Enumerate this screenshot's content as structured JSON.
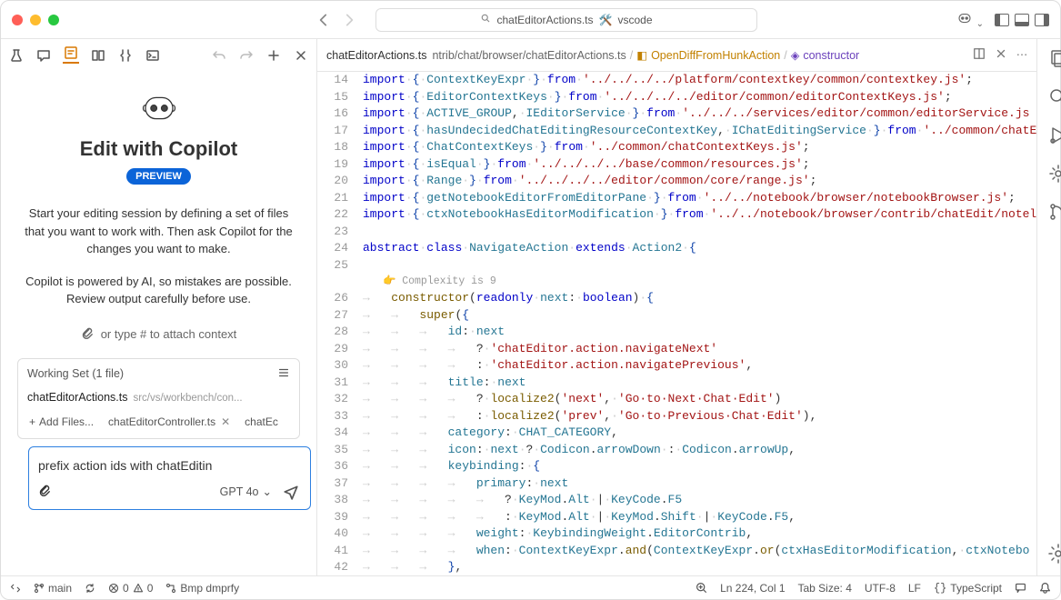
{
  "titlebar": {
    "command_center": "chatEditorActions.ts",
    "cc_badge": "vscode"
  },
  "sidebar": {
    "title": "Edit with Copilot",
    "preview": "PREVIEW",
    "desc1": "Start your editing session by defining a set of files that you want to work with. Then ask Copilot for the changes you want to make.",
    "desc2": "Copilot is powered by AI, so mistakes are possible. Review output carefully before use.",
    "attach_hint": "or type # to attach context",
    "working_set": {
      "header": "Working Set (1 file)",
      "file_name": "chatEditorActions.ts",
      "file_path": "src/vs/workbench/con...",
      "add_files": "Add Files...",
      "pill1": "chatEditorController.ts",
      "pill2": "chatEc"
    },
    "chat_input": "prefix action ids with chatEditin",
    "model": "GPT 4o"
  },
  "editor": {
    "tab_name": "chatEditorActions.ts",
    "breadcrumb": {
      "p1": "ntrib/chat/browser/chatEditorActions.ts",
      "p2": "OpenDiffFromHunkAction",
      "p3": "constructor"
    },
    "codelens": "Complexity is 9",
    "lines": [
      {
        "n": 14,
        "html": "<span class='kw'>import</span><span class='ws'>·</span><span class='br'>{</span><span class='ws'>·</span><span class='id'>ContextKeyExpr</span><span class='ws'>·</span><span class='br'>}</span><span class='ws'>·</span><span class='kw'>from</span><span class='ws'>·</span><span class='str'>'../../../../platform/contextkey/common/contextkey.js'</span>;"
      },
      {
        "n": 15,
        "html": "<span class='kw'>import</span><span class='ws'>·</span><span class='br'>{</span><span class='ws'>·</span><span class='id'>EditorContextKeys</span><span class='ws'>·</span><span class='br'>}</span><span class='ws'>·</span><span class='kw'>from</span><span class='ws'>·</span><span class='str'>'../../../../editor/common/editorContextKeys.js'</span>;"
      },
      {
        "n": 16,
        "html": "<span class='kw'>import</span><span class='ws'>·</span><span class='br'>{</span><span class='ws'>·</span><span class='id'>ACTIVE_GROUP</span>,<span class='ws'>·</span><span class='id'>IEditorService</span><span class='ws'>·</span><span class='br'>}</span><span class='ws'>·</span><span class='kw'>from</span><span class='ws'>·</span><span class='str'>'../../../services/editor/common/editorService.js</span>"
      },
      {
        "n": 17,
        "html": "<span class='kw'>import</span><span class='ws'>·</span><span class='br'>{</span><span class='ws'>·</span><span class='id'>hasUndecidedChatEditingResourceContextKey</span>,<span class='ws'>·</span><span class='id'>IChatEditingService</span><span class='ws'>·</span><span class='br'>}</span><span class='ws'>·</span><span class='kw'>from</span><span class='ws'>·</span><span class='str'>'../common/chatE</span>"
      },
      {
        "n": 18,
        "html": "<span class='kw'>import</span><span class='ws'>·</span><span class='br'>{</span><span class='ws'>·</span><span class='id'>ChatContextKeys</span><span class='ws'>·</span><span class='br'>}</span><span class='ws'>·</span><span class='kw'>from</span><span class='ws'>·</span><span class='str'>'../common/chatContextKeys.js'</span>;"
      },
      {
        "n": 19,
        "html": "<span class='kw'>import</span><span class='ws'>·</span><span class='br'>{</span><span class='ws'>·</span><span class='id'>isEqual</span><span class='ws'>·</span><span class='br'>}</span><span class='ws'>·</span><span class='kw'>from</span><span class='ws'>·</span><span class='str'>'../../../../base/common/resources.js'</span>;"
      },
      {
        "n": 20,
        "html": "<span class='kw'>import</span><span class='ws'>·</span><span class='br'>{</span><span class='ws'>·</span><span class='id'>Range</span><span class='ws'>·</span><span class='br'>}</span><span class='ws'>·</span><span class='kw'>from</span><span class='ws'>·</span><span class='str'>'../../../../editor/common/core/range.js'</span>;"
      },
      {
        "n": 21,
        "html": "<span class='kw'>import</span><span class='ws'>·</span><span class='br'>{</span><span class='ws'>·</span><span class='id'>getNotebookEditorFromEditorPane</span><span class='ws'>·</span><span class='br'>}</span><span class='ws'>·</span><span class='kw'>from</span><span class='ws'>·</span><span class='str'>'../../notebook/browser/notebookBrowser.js'</span>;"
      },
      {
        "n": 22,
        "html": "<span class='kw'>import</span><span class='ws'>·</span><span class='br'>{</span><span class='ws'>·</span><span class='id'>ctxNotebookHasEditorModification</span><span class='ws'>·</span><span class='br'>}</span><span class='ws'>·</span><span class='kw'>from</span><span class='ws'>·</span><span class='str'>'../../notebook/browser/contrib/chatEdit/notel</span>"
      },
      {
        "n": 23,
        "html": ""
      },
      {
        "n": 24,
        "html": "<span class='kw'>abstract</span><span class='ws'>·</span><span class='kw'>class</span><span class='ws'>·</span><span class='id'>NavigateAction</span><span class='ws'>·</span><span class='kw'>extends</span><span class='ws'>·</span><span class='id'>Action2</span><span class='ws'>·</span><span class='br'>{</span>"
      },
      {
        "n": 25,
        "html": ""
      },
      {
        "n": 26,
        "html": "<span class='arrow'>→   </span><span class='fn'>constructor</span>(<span class='kw'>readonly</span><span class='ws'>·</span><span class='id'>next</span>:<span class='ws'>·</span><span class='bool'>boolean</span>)<span class='ws'>·</span><span class='br'>{</span>",
        "lens": true
      },
      {
        "n": 27,
        "html": "<span class='arrow'>→   →   </span><span class='fn'>super</span>(<span class='br'>{</span>"
      },
      {
        "n": 28,
        "html": "<span class='arrow'>→   →   →   </span><span class='id'>id</span>:<span class='ws'>·</span><span class='id'>next</span>"
      },
      {
        "n": 29,
        "html": "<span class='arrow'>→   →   →   →   </span>?<span class='ws'>·</span><span class='str'>'chatEditor.action.navigateNext'</span>"
      },
      {
        "n": 30,
        "html": "<span class='arrow'>→   →   →   →   </span>:<span class='ws'>·</span><span class='str'>'chatEditor.action.navigatePrevious'</span>,"
      },
      {
        "n": 31,
        "html": "<span class='arrow'>→   →   →   </span><span class='id'>title</span>:<span class='ws'>·</span><span class='id'>next</span>"
      },
      {
        "n": 32,
        "html": "<span class='arrow'>→   →   →   →   </span>?<span class='ws'>·</span><span class='fn'>localize2</span>(<span class='str'>'next'</span>,<span class='ws'>·</span><span class='str'>'Go·to·Next·Chat·Edit'</span>)"
      },
      {
        "n": 33,
        "html": "<span class='arrow'>→   →   →   →   </span>:<span class='ws'>·</span><span class='fn'>localize2</span>(<span class='str'>'prev'</span>,<span class='ws'>·</span><span class='str'>'Go·to·Previous·Chat·Edit'</span>),"
      },
      {
        "n": 34,
        "html": "<span class='arrow'>→   →   →   </span><span class='id'>category</span>:<span class='ws'>·</span><span class='id'>CHAT_CATEGORY</span>,"
      },
      {
        "n": 35,
        "html": "<span class='arrow'>→   →   →   </span><span class='id'>icon</span>:<span class='ws'>·</span><span class='id'>next</span><span class='ws'>·</span>?<span class='ws'>·</span><span class='id'>Codicon</span>.<span class='id'>arrowDown</span><span class='ws'>·</span>:<span class='ws'>·</span><span class='id'>Codicon</span>.<span class='id'>arrowUp</span>,"
      },
      {
        "n": 36,
        "html": "<span class='arrow'>→   →   →   </span><span class='id'>keybinding</span>:<span class='ws'>·</span><span class='br'>{</span>"
      },
      {
        "n": 37,
        "html": "<span class='arrow'>→   →   →   →   </span><span class='id'>primary</span>:<span class='ws'>·</span><span class='id'>next</span>"
      },
      {
        "n": 38,
        "html": "<span class='arrow'>→   →   →   →   →   </span>?<span class='ws'>·</span><span class='id'>KeyMod</span>.<span class='id'>Alt</span><span class='ws'>·</span>|<span class='ws'>·</span><span class='id'>KeyCode</span>.<span class='id'>F5</span>"
      },
      {
        "n": 39,
        "html": "<span class='arrow'>→   →   →   →   →   </span>:<span class='ws'>·</span><span class='id'>KeyMod</span>.<span class='id'>Alt</span><span class='ws'>·</span>|<span class='ws'>·</span><span class='id'>KeyMod</span>.<span class='id'>Shift</span><span class='ws'>·</span>|<span class='ws'>·</span><span class='id'>KeyCode</span>.<span class='id'>F5</span>,"
      },
      {
        "n": 40,
        "html": "<span class='arrow'>→   →   →   →   </span><span class='id'>weight</span>:<span class='ws'>·</span><span class='id'>KeybindingWeight</span>.<span class='id'>EditorContrib</span>,"
      },
      {
        "n": 41,
        "html": "<span class='arrow'>→   →   →   →   </span><span class='id'>when</span>:<span class='ws'>·</span><span class='id'>ContextKeyExpr</span>.<span class='fn'>and</span>(<span class='id'>ContextKeyExpr</span>.<span class='fn'>or</span>(<span class='id'>ctxHasEditorModification</span>,<span class='ws'>·</span><span class='id'>ctxNotebo</span>"
      },
      {
        "n": 42,
        "html": "<span class='arrow'>→   →   →   </span><span class='br'>}</span>,"
      }
    ]
  },
  "statusbar": {
    "branch": "main",
    "errors": "0",
    "warnings": "0",
    "bmp": "Bmp dmprfy",
    "lncol": "Ln 224, Col 1",
    "tabsize": "Tab Size: 4",
    "encoding": "UTF-8",
    "eol": "LF",
    "lang": "TypeScript"
  }
}
